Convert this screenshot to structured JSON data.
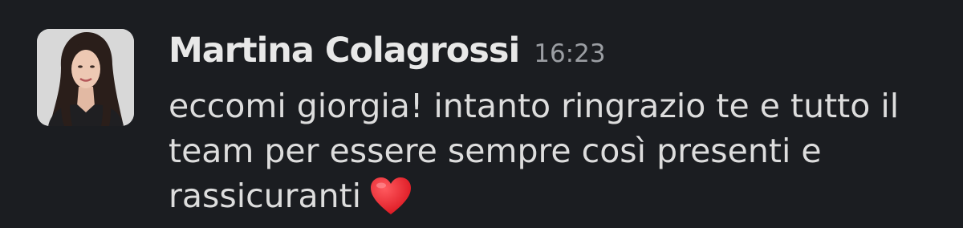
{
  "message": {
    "author": "Martina Colagrossi",
    "timestamp": "16:23",
    "lines": [
      "eccomi giorgia! intanto ringrazio te e tutto il",
      "team per essere sempre così presenti e",
      "rassicuranti"
    ],
    "emoji": "red-heart",
    "colors": {
      "background": "#1b1d21",
      "author": "#e8e8e8",
      "timestamp": "#9b9ea3",
      "text": "#dddddd",
      "heart": "#e0242b"
    }
  }
}
